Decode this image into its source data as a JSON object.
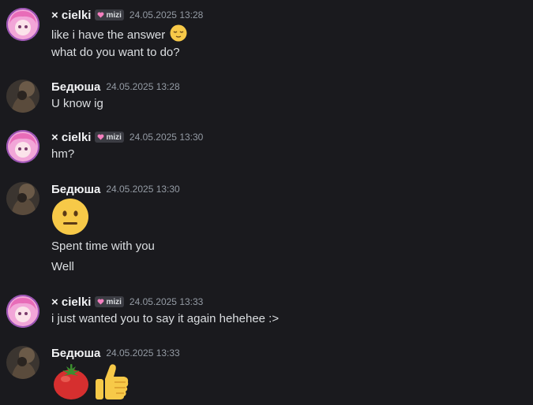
{
  "colors": {
    "background": "#1a1a1e",
    "text": "#dbdee1",
    "timestamp": "#949ba4"
  },
  "messages": [
    {
      "username": "× cielki",
      "tag": "mizi",
      "timestamp": "24.05.2025 13:28",
      "lines": [
        "like i have the answer",
        "what do you want to do?"
      ],
      "emoji": "relieved-face"
    },
    {
      "username": "Бедюша",
      "timestamp": "24.05.2025 13:28",
      "lines": [
        "U know ig"
      ]
    },
    {
      "username": "× cielki",
      "tag": "mizi",
      "timestamp": "24.05.2025 13:30",
      "lines": [
        "hm?"
      ]
    },
    {
      "username": "Бедюша",
      "timestamp": "24.05.2025 13:30",
      "emoji": "neutral-face",
      "lines": [
        "Spent time with you",
        "Well"
      ]
    },
    {
      "username": "× cielki",
      "tag": "mizi",
      "timestamp": "24.05.2025 13:33",
      "lines": [
        "i just wanted you to say it again hehehee :>"
      ]
    },
    {
      "username": "Бедюша",
      "timestamp": "24.05.2025 13:33",
      "emojis": [
        "tomato",
        "thumbs-up"
      ]
    }
  ]
}
